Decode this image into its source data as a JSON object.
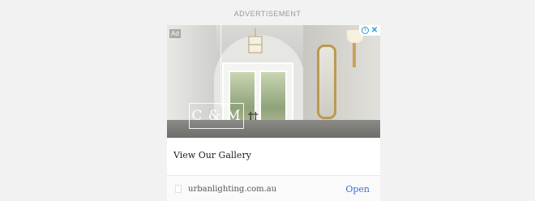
{
  "ad_label": "ADVERTISEMENT",
  "ad_badge": "Ad",
  "logo": {
    "text": "C & M",
    "mark": "††"
  },
  "headline": "View Our Gallery",
  "advertiser_domain": "urbanlighting.com.au",
  "cta_label": "Open",
  "icons": {
    "adchoices": "adchoices-icon",
    "close": "close-icon",
    "favicon": "favicon-icon"
  },
  "colors": {
    "accent": "#1a9ed9",
    "cta": "#3a6fd9",
    "background": "#f2f2f2"
  }
}
